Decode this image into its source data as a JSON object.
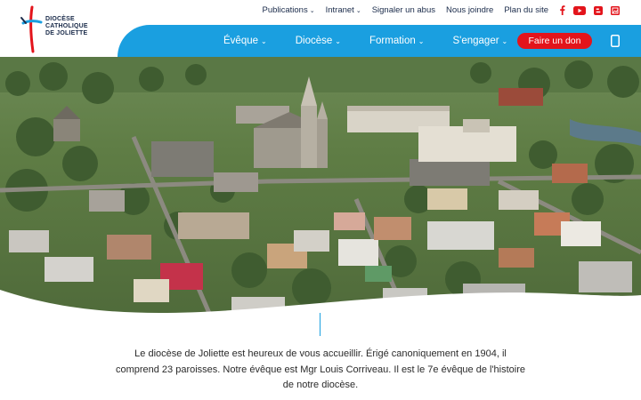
{
  "logo": {
    "line1": "DIOCÈSE",
    "line2": "CATHOLIQUE",
    "line3": "DE JOLIETTE",
    "colors": {
      "red": "#e3141b",
      "blue": "#1a9fe0",
      "navy": "#1a2b4a"
    }
  },
  "top_nav": {
    "items": [
      {
        "label": "Publications",
        "has_dropdown": true
      },
      {
        "label": "Intranet",
        "has_dropdown": true
      },
      {
        "label": "Signaler un abus",
        "has_dropdown": false
      },
      {
        "label": "Nous joindre",
        "has_dropdown": false
      },
      {
        "label": "Plan du site",
        "has_dropdown": false
      }
    ],
    "social_icons": [
      "facebook-icon",
      "youtube-icon",
      "blogger-icon",
      "flickr-icon"
    ],
    "social_color": "#e3141b"
  },
  "main_nav": {
    "items": [
      {
        "label": "Évêque",
        "has_dropdown": true
      },
      {
        "label": "Diocèse",
        "has_dropdown": true
      },
      {
        "label": "Formation",
        "has_dropdown": true
      },
      {
        "label": "S'engager",
        "has_dropdown": true
      }
    ],
    "donate_label": "Faire un don",
    "menu_icon": "hamburger-icon",
    "bar_color": "#1a9fe0",
    "donate_color": "#e3141b"
  },
  "hero": {
    "image": "aerial-city-cathedral-photo"
  },
  "intro": {
    "text": "Le diocèse de Joliette est heureux de vous accueillir. Érigé canoniquement en 1904, il comprend 23 paroisses. Notre évêque est Mgr Louis Corriveau. Il est le 7e évêque de l'histoire de notre diocèse."
  }
}
